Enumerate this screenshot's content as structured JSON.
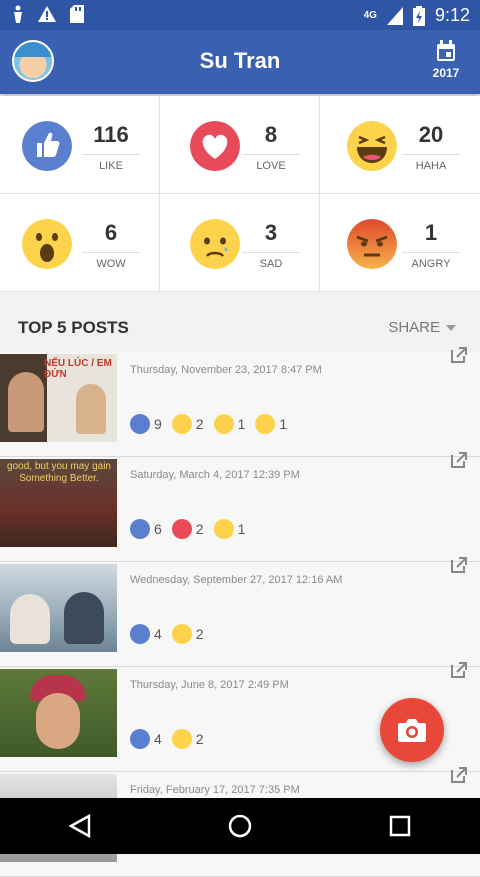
{
  "status": {
    "network": "4G",
    "time": "9:12"
  },
  "header": {
    "title": "Su Tran",
    "year": "2017"
  },
  "stats": [
    {
      "count": "116",
      "label": "LIKE",
      "icon": "like-icon"
    },
    {
      "count": "8",
      "label": "LOVE",
      "icon": "love-icon"
    },
    {
      "count": "20",
      "label": "HAHA",
      "icon": "haha-icon"
    },
    {
      "count": "6",
      "label": "WOW",
      "icon": "wow-icon"
    },
    {
      "count": "3",
      "label": "SAD",
      "icon": "sad-icon"
    },
    {
      "count": "1",
      "label": "ANGRY",
      "icon": "angry-icon"
    }
  ],
  "section": {
    "title": "TOP 5 POSTS",
    "share_label": "SHARE"
  },
  "posts": [
    {
      "date": "Thursday, November 23, 2017 8:47 PM",
      "thumb_text": "NẾU LÚC / EM ĐỨN",
      "reactions": [
        {
          "type": "like",
          "count": "9"
        },
        {
          "type": "haha",
          "count": "2"
        },
        {
          "type": "wow",
          "count": "1"
        },
        {
          "type": "sad",
          "count": "1"
        }
      ]
    },
    {
      "date": "Saturday, March 4, 2017 12:39 PM",
      "thumb_text": "good, but you may gain Something Better.",
      "reactions": [
        {
          "type": "like",
          "count": "6"
        },
        {
          "type": "love",
          "count": "2"
        },
        {
          "type": "wow",
          "count": "1"
        }
      ]
    },
    {
      "date": "Wednesday, September 27, 2017 12:16 AM",
      "thumb_text": "",
      "reactions": [
        {
          "type": "like",
          "count": "4"
        },
        {
          "type": "haha",
          "count": "2"
        }
      ]
    },
    {
      "date": "Thursday, June 8, 2017 2:49 PM",
      "thumb_text": "",
      "reactions": [
        {
          "type": "like",
          "count": "4"
        },
        {
          "type": "sad",
          "count": "2"
        }
      ]
    },
    {
      "date": "Friday, February 17, 2017 7:35 PM",
      "thumb_text": "",
      "reactions": []
    }
  ],
  "colors": {
    "primary": "#3a60b1",
    "status": "#2f56a4",
    "fab": "#e9473a",
    "like": "#5b7fcf",
    "love": "#e84a5a",
    "emoji": "#fcd34a",
    "angry": "#ec6e3b"
  }
}
